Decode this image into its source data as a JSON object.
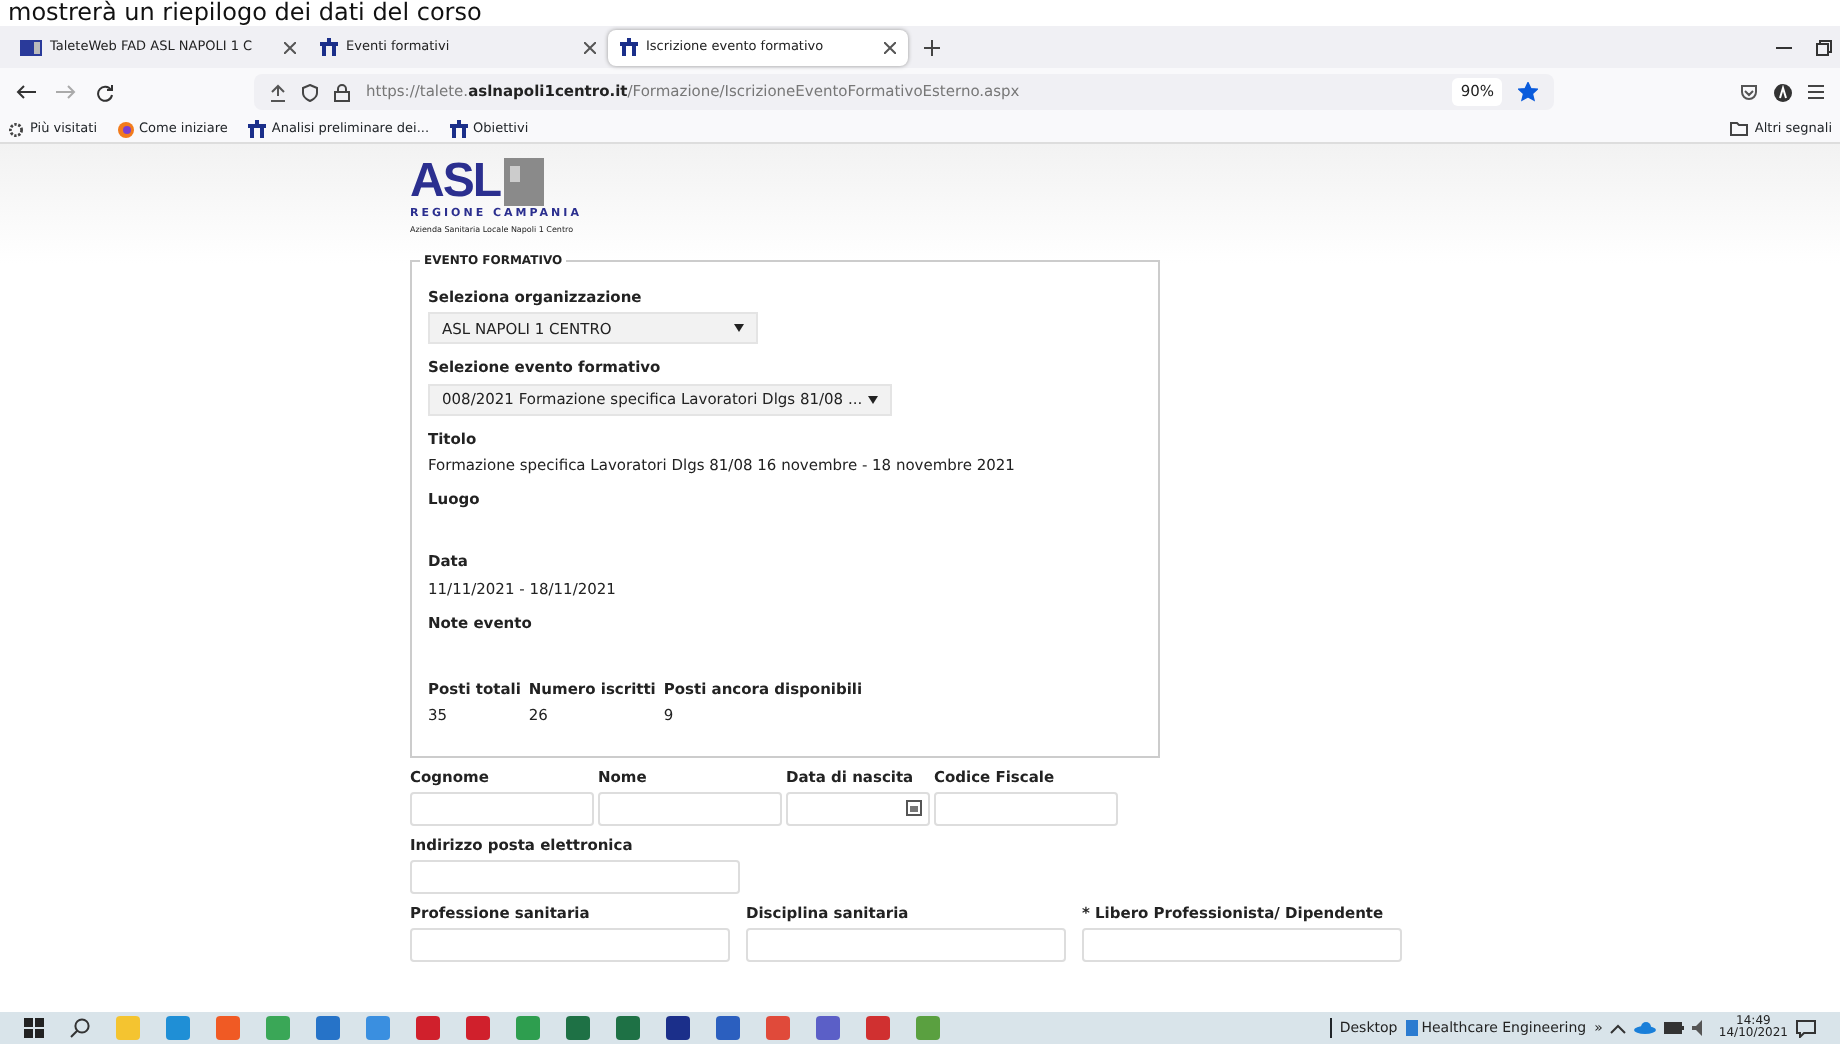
{
  "caption": "mostrerà un riepilogo dei dati del corso",
  "browser": {
    "tabs": [
      {
        "label": "TaleteWeb FAD ASL NAPOLI 1 C",
        "selected": false,
        "kind": "asl"
      },
      {
        "label": "Eventi formativi",
        "selected": false,
        "kind": "talete"
      },
      {
        "label": "Iscrizione evento formativo",
        "selected": true,
        "kind": "talete"
      }
    ],
    "url": "https://talete.**aslnapoli1centro.it**/Formazione/IscrizioneEventoFormativoEsterno.aspx",
    "zoom": "90%",
    "bookmarked": true,
    "bookmarks": [
      {
        "label": "Più visitati",
        "kind": "gear"
      },
      {
        "label": "Come iniziare",
        "kind": "firefox"
      },
      {
        "label": "Analisi preliminare dei...",
        "kind": "talete"
      },
      {
        "label": "Obiettivi",
        "kind": "talete"
      }
    ],
    "other_bookmarks": "Altri segnali"
  },
  "logo": {
    "mark": "ASL",
    "line1": "REGIONE CAMPANIA",
    "line2": "Azienda Sanitaria Locale Napoli 1 Centro"
  },
  "event": {
    "legend": "EVENTO FORMATIVO",
    "organization": {
      "label": "Seleziona organizzazione",
      "value": "ASL NAPOLI 1 CENTRO"
    },
    "event_select": {
      "label": "Selezione evento formativo",
      "value": "008/2021 Formazione specifica Lavoratori Dlgs 81/08  ..."
    },
    "details": [
      {
        "label": "Titolo",
        "value": "Formazione specifica Lavoratori Dlgs 81/08 16 novembre - 18 novembre 2021"
      },
      {
        "label": "Luogo"
      },
      {
        "label": "Data",
        "value": "11/11/2021 - 18/11/2021"
      },
      {
        "label": "Note evento"
      }
    ],
    "seats": [
      {
        "label": "Posti totali",
        "value": "35"
      },
      {
        "label": "Numero iscritti",
        "value": "26"
      },
      {
        "label": "Posti ancora disponibili",
        "value": "9"
      }
    ]
  },
  "form": {
    "row1": [
      {
        "label": "Cognome",
        "kind": "text"
      },
      {
        "label": "Nome",
        "kind": "text"
      },
      {
        "label": "Data di nascita",
        "kind": "date"
      },
      {
        "label": "Codice Fiscale",
        "kind": "text"
      }
    ],
    "email": {
      "label": "Indirizzo posta elettronica"
    },
    "row3": [
      {
        "label": "Professione sanitaria"
      },
      {
        "label": "Disciplina sanitaria"
      },
      {
        "label": "* Libero Professionista/ Dipendente"
      }
    ]
  },
  "taskbar": {
    "desktop": "Desktop",
    "toolbar": "Healthcare Engineering",
    "chevron": "»",
    "time": "14:49",
    "date": "14/10/2021"
  }
}
